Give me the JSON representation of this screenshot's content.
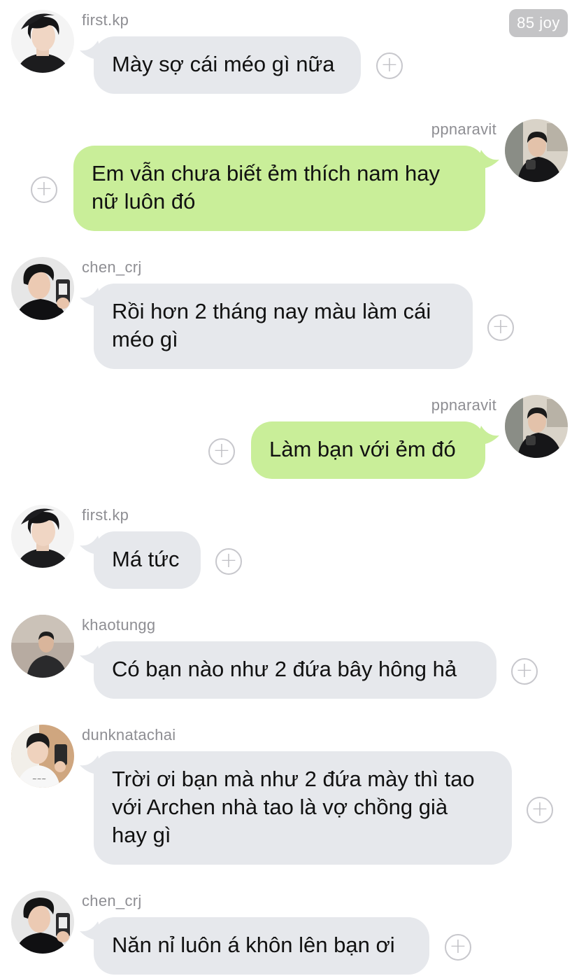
{
  "header": {
    "badge": "85 joy"
  },
  "messages": [
    {
      "user": "first.kp",
      "text": "Mày sợ cái méo gì nữa",
      "side": "left",
      "avatar": "avatar-first-kp"
    },
    {
      "user": "ppnaravit",
      "text": "Em vẫn chưa biết ẻm thích nam hay\nnữ luôn đó",
      "side": "right",
      "avatar": "avatar-ppnaravit"
    },
    {
      "user": "chen_crj",
      "text": "Rồi hơn 2 tháng nay màu làm cái\nméo gì",
      "side": "left",
      "avatar": "avatar-chen-crj"
    },
    {
      "user": "ppnaravit",
      "text": "Làm bạn với ẻm đó",
      "side": "right",
      "avatar": "avatar-ppnaravit"
    },
    {
      "user": "first.kp",
      "text": "Má tức",
      "side": "left",
      "avatar": "avatar-first-kp"
    },
    {
      "user": "khaotungg",
      "text": "Có bạn nào như 2 đứa bây hông hả",
      "side": "left",
      "avatar": "avatar-khaotungg"
    },
    {
      "user": "dunknatachai",
      "text": "Trời ơi bạn mà như 2 đứa mày thì tao\nvới Archen nhà tao là vợ chồng già\nhay gì",
      "side": "left",
      "avatar": "avatar-dunknatachai"
    },
    {
      "user": "chen_crj",
      "text": "Năn nỉ luôn á khôn lên bạn ơi",
      "side": "left",
      "avatar": "avatar-chen-crj"
    }
  ],
  "icons": {
    "react_button": "plus-circle-icon",
    "react_glyph": "+"
  },
  "colors": {
    "incoming_bubble": "#e6e8ec",
    "outgoing_bubble": "#c9ee99",
    "username": "#8e8e93",
    "badge_bg": "#c4c4c6"
  }
}
